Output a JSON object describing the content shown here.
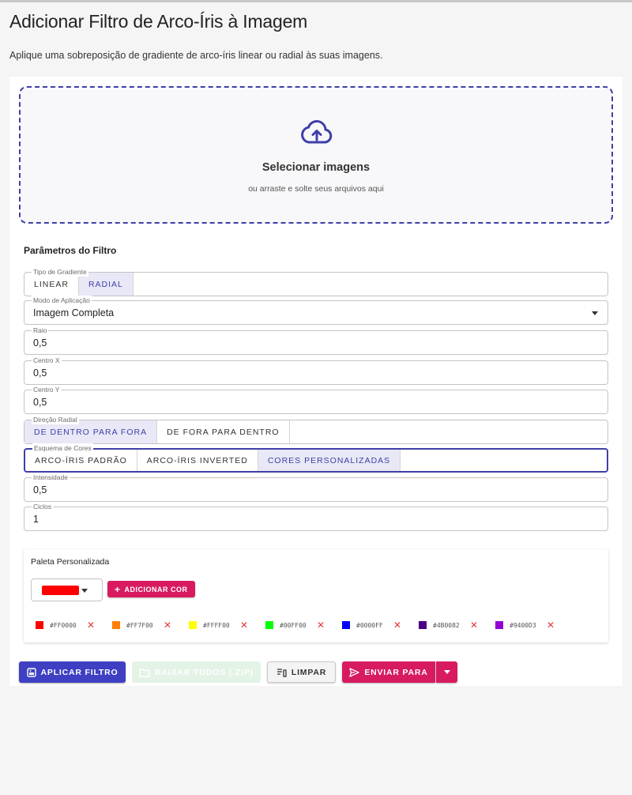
{
  "header": {
    "title": "Adicionar Filtro de Arco-Íris à Imagem",
    "description": "Aplique uma sobreposição de gradiente de arco-íris linear ou radial às suas imagens."
  },
  "dropzone": {
    "icon": "cloud-upload-icon",
    "title": "Selecionar imagens",
    "subtitle": "ou arraste e solte seus arquivos aqui"
  },
  "params": {
    "section_title": "Parâmetros do Filtro",
    "gradient_type": {
      "label": "Tipo de Gradiente",
      "options": [
        "LINEAR",
        "RADIAL"
      ],
      "selected": "RADIAL"
    },
    "apply_mode": {
      "label": "Modo de Aplicação",
      "value": "Imagem Completa"
    },
    "radius": {
      "label": "Raio",
      "value": "0,5"
    },
    "center_x": {
      "label": "Centro X",
      "value": "0,5"
    },
    "center_y": {
      "label": "Centro Y",
      "value": "0,5"
    },
    "radial_direction": {
      "label": "Direção Radial",
      "options": [
        "DE DENTRO PARA FORA",
        "DE FORA PARA DENTRO"
      ],
      "selected": "DE DENTRO PARA FORA"
    },
    "color_scheme": {
      "label": "Esquema de Cores",
      "options": [
        "ARCO-ÍRIS PADRÃO",
        "ARCO-ÍRIS INVERTED",
        "CORES PERSONALIZADAS"
      ],
      "selected": "CORES PERSONALIZADAS"
    },
    "intensity": {
      "label": "Intensidade",
      "value": "0,5"
    },
    "cycles": {
      "label": "Ciclos",
      "value": "1"
    }
  },
  "palette": {
    "title": "Paleta Personalizada",
    "picker_color": "#FF0000",
    "add_label": "ADICIONAR COR",
    "colors": [
      "#FF0000",
      "#FF7F00",
      "#FFFF00",
      "#00FF00",
      "#0000FF",
      "#4B0082",
      "#9400D3"
    ]
  },
  "actions": {
    "apply": "APLICAR FILTRO",
    "download_zip": "BAIXAR TODOS (.ZIP)",
    "clear": "LIMPAR",
    "send_to": "ENVIAR PARA"
  },
  "colors": {
    "primary": "#3f3fc4",
    "secondary": "#d81b60",
    "delete": "#e53935"
  }
}
